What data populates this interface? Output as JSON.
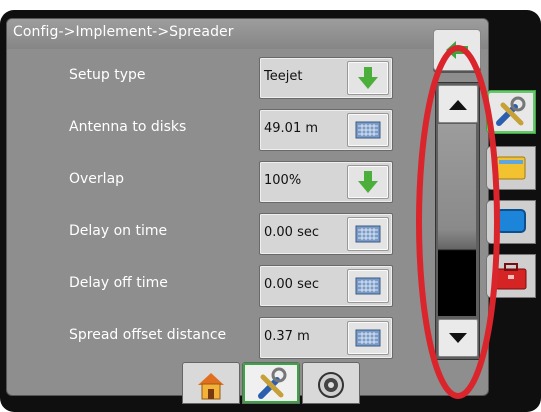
{
  "header": {
    "breadcrumb": "Config->Implement->Spreader"
  },
  "settings": [
    {
      "label": "Setup type",
      "value": "Teejet",
      "control": "down-arrow-icon"
    },
    {
      "label": "Antenna to disks",
      "value": "49.01 m",
      "control": "keyboard-icon"
    },
    {
      "label": "Overlap",
      "value": "100%",
      "control": "down-arrow-icon"
    },
    {
      "label": "Delay on time",
      "value": "0.00 sec",
      "control": "keyboard-icon"
    },
    {
      "label": "Delay off time",
      "value": "0.00 sec",
      "control": "keyboard-icon"
    },
    {
      "label": "Spread offset distance",
      "value": "0.37 m",
      "control": "keyboard-icon"
    }
  ],
  "scrollbar": {
    "up": "scroll-up-icon",
    "down": "scroll-down-icon",
    "position": 1.0
  },
  "side_tabs": [
    "tools-icon",
    "folder-icon",
    "monitor-icon",
    "toolbox-icon"
  ],
  "bottom_nav": [
    "home-icon",
    "tools-icon",
    "gauge-icon"
  ],
  "colors": {
    "accent": "#3aa641",
    "annotation": "#d9252b",
    "screen_bg": "#8e8e8e"
  }
}
